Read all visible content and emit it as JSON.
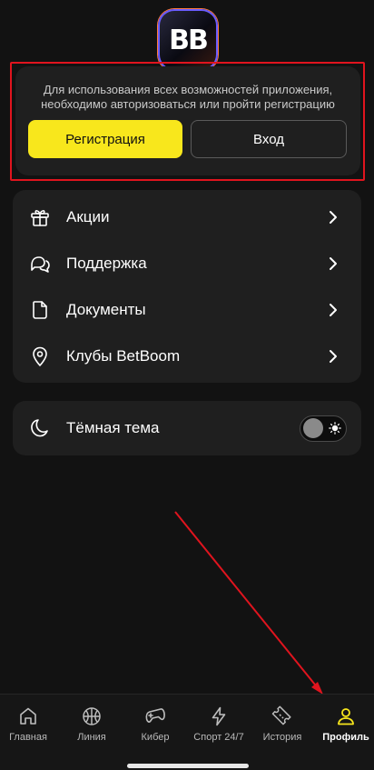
{
  "app": {
    "logo_text": "BB",
    "accent_color": "#f8e71c",
    "highlight_color": "#e0141e"
  },
  "auth": {
    "message_line1": "Для использования всех возможностей приложения,",
    "message_line2": "необходимо авторизоваться или пройти регистрацию",
    "register_label": "Регистрация",
    "login_label": "Вход"
  },
  "menu": {
    "items": [
      {
        "label": "Акции",
        "icon": "gift-icon"
      },
      {
        "label": "Поддержка",
        "icon": "chat-bubbles-icon"
      },
      {
        "label": "Документы",
        "icon": "document-icon"
      },
      {
        "label": "Клубы BetBoom",
        "icon": "location-pin-icon"
      }
    ]
  },
  "theme": {
    "label": "Тёмная тема",
    "icon": "moon-icon",
    "toggle_icon": "sun-icon",
    "enabled": false
  },
  "bottom_nav": {
    "items": [
      {
        "label": "Главная",
        "icon": "home-icon"
      },
      {
        "label": "Линия",
        "icon": "basketball-icon"
      },
      {
        "label": "Кибер",
        "icon": "gamepad-icon"
      },
      {
        "label": "Спорт 24/7",
        "icon": "lightning-icon"
      },
      {
        "label": "История",
        "icon": "ticket-icon"
      },
      {
        "label": "Профиль",
        "icon": "profile-icon"
      }
    ],
    "active": "Профиль"
  }
}
